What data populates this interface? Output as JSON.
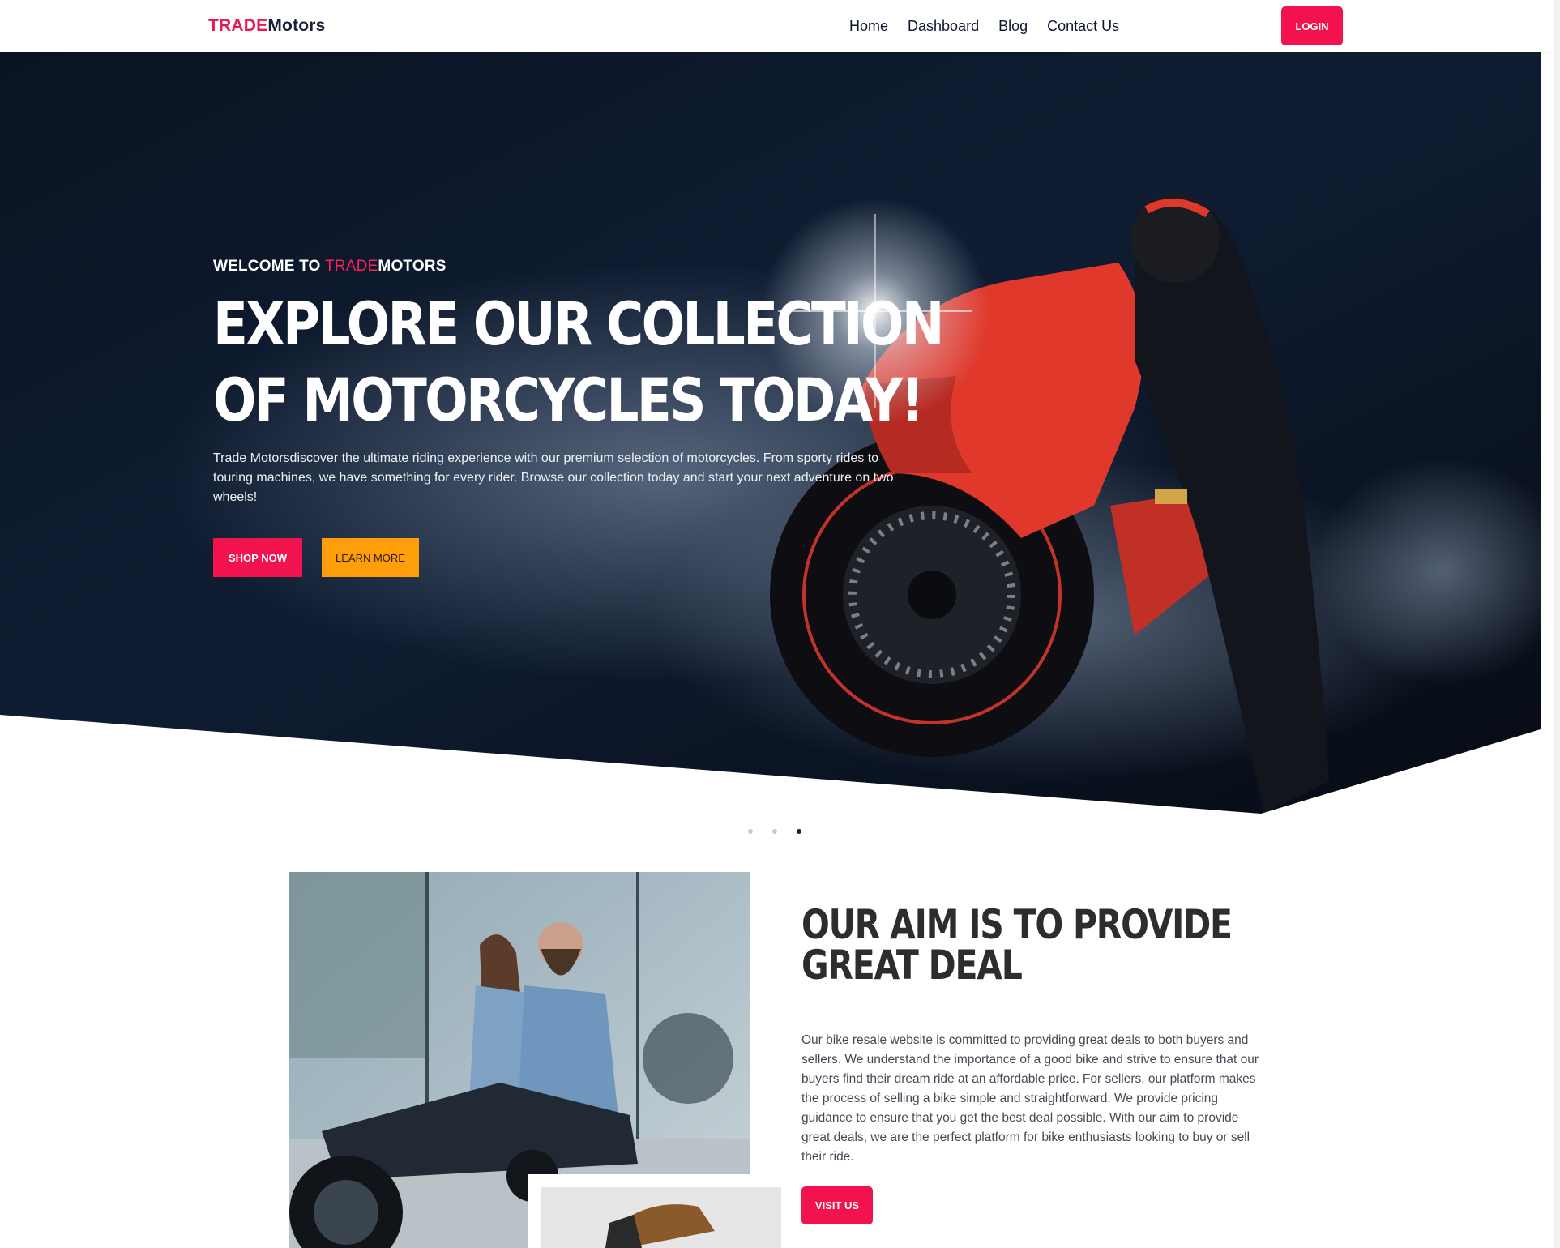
{
  "navbar": {
    "brand_part1": "TRADE",
    "brand_part2": "Motors",
    "links": [
      "Home",
      "Dashboard",
      "Blog",
      "Contact Us"
    ],
    "login_label": "LOGIN"
  },
  "hero": {
    "welcome_prefix": "WELCOME TO ",
    "welcome_accent": "TRADE",
    "welcome_suffix": "MOTORS",
    "title_line1": "EXPLORE OUR COLLECTION",
    "title_line2": "OF MOTORCYCLES TODAY!",
    "description": "Trade Motorsdiscover the ultimate riding experience with our premium selection of motorcycles. From sporty rides to touring machines, we have something for every rider. Browse our collection today and start your next adventure on two wheels!",
    "shop_label": "SHOP NOW",
    "learn_label": "LEARN MORE"
  },
  "carousel": {
    "slides": 3,
    "active_index": 2
  },
  "about": {
    "title_line1": "OUR AIM IS TO PROVIDE",
    "title_line2": "GREAT DEAL",
    "text": "Our bike resale website is committed to providing great deals to both buyers and sellers. We understand the importance of a good bike and strive to ensure that our buyers find their dream ride at an affordable price. For sellers, our platform makes the process of selling a bike simple and straightforward. We provide pricing guidance to ensure that you get the best deal possible. With our aim to provide great deals, we are the perfect platform for bike enthusiasts looking to buy or sell their ride.",
    "visit_label": "VISIT US"
  },
  "colors": {
    "accent": "#f2124e",
    "secondary": "#ff9e0b",
    "hero_dark": "#0a1322"
  }
}
